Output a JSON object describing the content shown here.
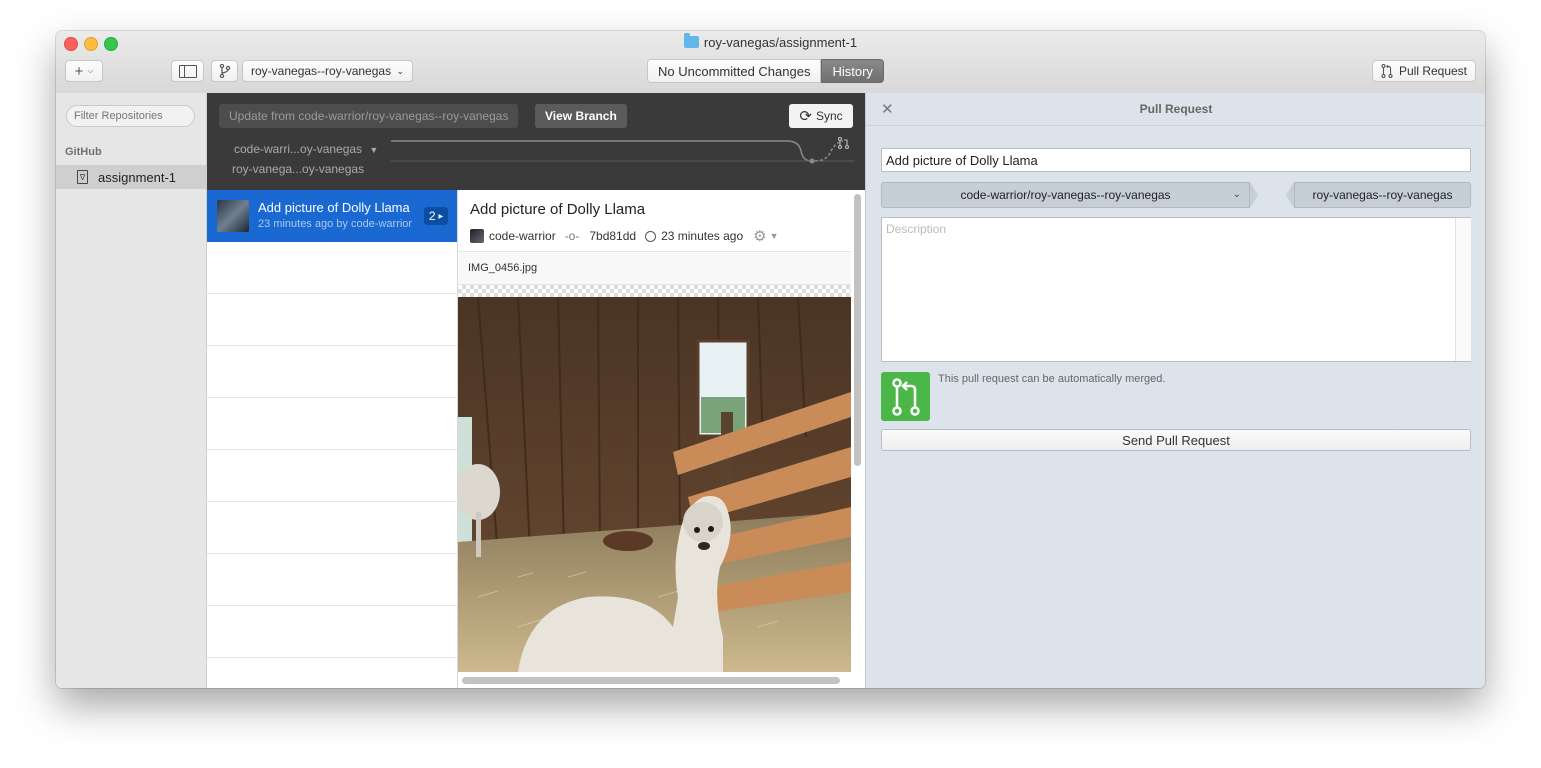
{
  "window": {
    "title": "roy-vanegas/assignment-1"
  },
  "toolbar": {
    "add_label": "+",
    "branch_select": "roy-vanegas--roy-vanegas",
    "mode_uncommitted": "No Uncommitted Changes",
    "mode_history": "History",
    "pull_request_label": "Pull Request"
  },
  "sidebar": {
    "filter_placeholder": "Filter Repositories",
    "section": "GitHub",
    "repos": [
      {
        "name": "assignment-1"
      }
    ]
  },
  "branchbar": {
    "update_label": "Update from code-warrior/roy-vanegas--roy-vanegas",
    "view_branch_label": "View Branch",
    "sync_label": "Sync",
    "branch_1": "code-warri...oy-vanegas",
    "branch_2": "roy-vanega...oy-vanegas"
  },
  "commits": [
    {
      "title": "Add picture of Dolly Llama",
      "subtitle": "23 minutes ago by code-warrior",
      "badge": "2"
    }
  ],
  "detail": {
    "title": "Add picture of Dolly Llama",
    "author": "code-warrior",
    "sha": "7bd81dd",
    "time": "23 minutes ago",
    "file": "IMG_0456.jpg"
  },
  "pull_request": {
    "header": "Pull Request",
    "title_value": "Add picture of Dolly Llama",
    "base_branch": "code-warrior/roy-vanegas--roy-vanegas",
    "head_branch": "roy-vanegas--roy-vanegas",
    "description_placeholder": "Description",
    "merge_status": "This pull request can be automatically merged.",
    "send_label": "Send Pull Request"
  },
  "colors": {
    "selection": "#1a68d1",
    "merge_ok": "#4cb749",
    "branch_header": "#3a3a3a"
  }
}
